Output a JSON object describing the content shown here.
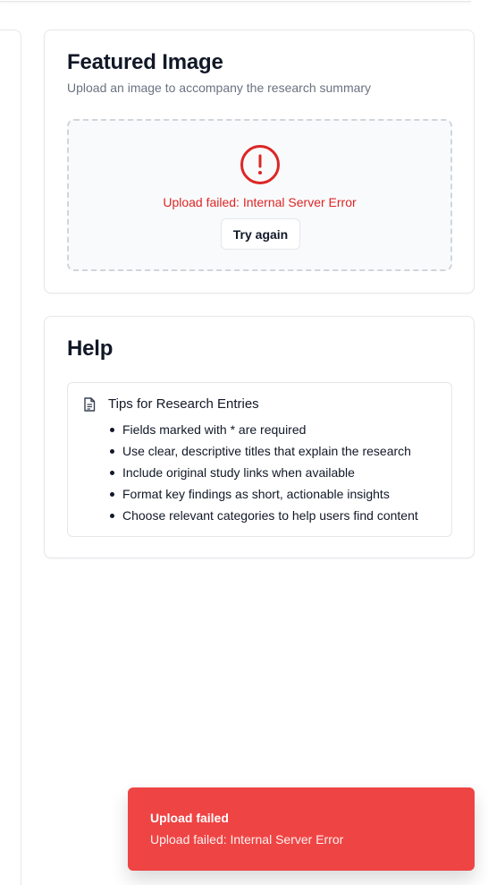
{
  "featured_image": {
    "title": "Featured Image",
    "subtitle": "Upload an image to accompany the research summary",
    "error_message": "Upload failed: Internal Server Error",
    "retry_label": "Try again"
  },
  "help": {
    "title": "Help",
    "tips_title": "Tips for Research Entries",
    "tips": [
      "Fields marked with * are required",
      "Use clear, descriptive titles that explain the research",
      "Include original study links when available",
      "Format key findings as short, actionable insights",
      "Choose relevant categories to help users find content"
    ]
  },
  "toast": {
    "title": "Upload failed",
    "description": "Upload failed: Internal Server Error"
  },
  "icons": {
    "error": "alert-circle-icon",
    "tips": "document-icon"
  },
  "colors": {
    "error": "#dc2626",
    "toast_bg": "#ef4444",
    "border": "#e5e7eb"
  }
}
